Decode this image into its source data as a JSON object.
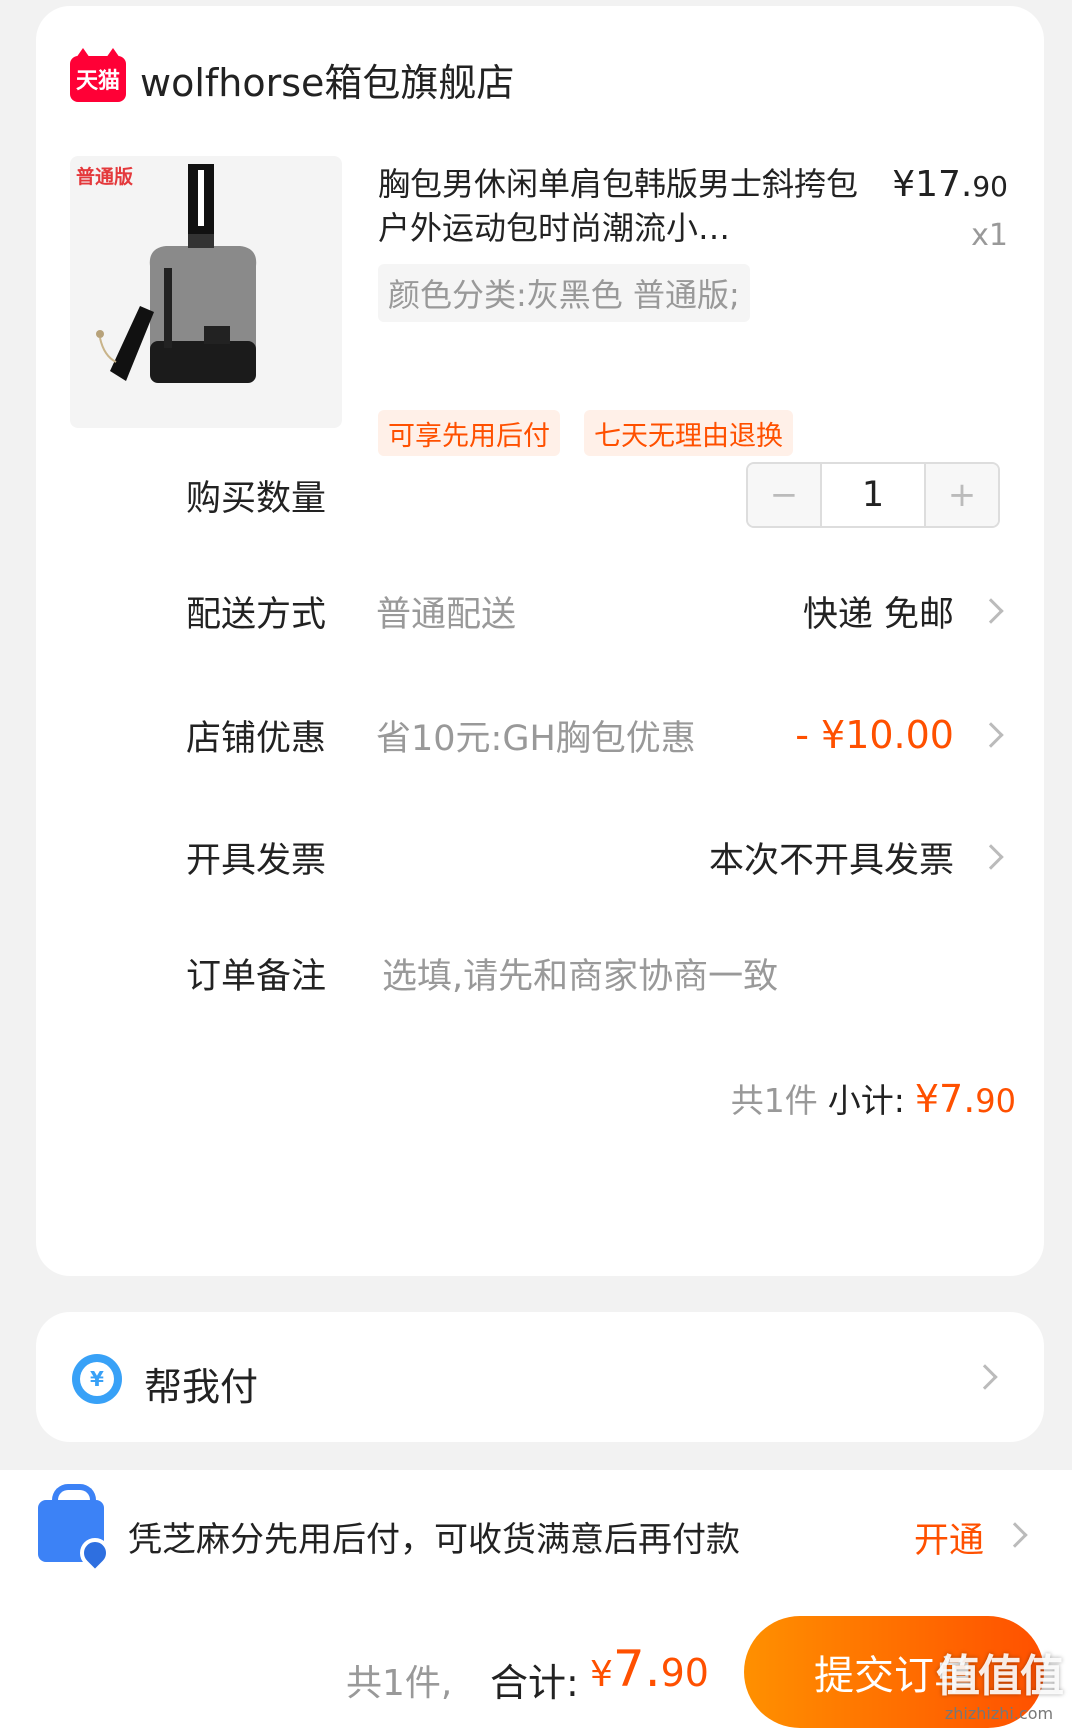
{
  "shop": {
    "badge": "天猫",
    "name": "wolfhorse箱包旗舰店"
  },
  "product": {
    "image_badge": "普通版",
    "title": "胸包男休闲单肩包韩版男士斜挎包户外运动包时尚潮流小…",
    "price_int": "¥17.",
    "price_dec": "90",
    "qty": "x1",
    "sku": "颜色分类:灰黑色 普通版;",
    "tags": [
      "可享先用后付",
      "七天无理由退换"
    ]
  },
  "rows": {
    "quantity_label": "购买数量",
    "quantity_value": "1",
    "minus": "−",
    "plus": "+",
    "delivery_label": "配送方式",
    "delivery_sub": "普通配送",
    "delivery_value": "快递 免邮",
    "discount_label": "店铺优惠",
    "discount_sub": "省10元:GH胸包优惠",
    "discount_value": "- ¥10.00",
    "invoice_label": "开具发票",
    "invoice_value": "本次不开具发票",
    "note_label": "订单备注",
    "note_placeholder": "选填,请先和商家协商一致"
  },
  "subtotal": {
    "count": "共1件",
    "label": "小计:",
    "price_int": "¥7.",
    "price_dec": "90"
  },
  "help_pay": {
    "icon_symbol": "¥",
    "label": "帮我付"
  },
  "pay_later": {
    "text": "凭芝麻分先用后付，可收货满意后再付款",
    "link": "开通"
  },
  "bottom": {
    "count": "共1件,",
    "total_label": "合计:",
    "currency": "¥",
    "total_int": "7.",
    "total_dec": "90",
    "submit": "提交订单"
  },
  "watermark": {
    "text": "值值值",
    "url": "zhizhizhi.com"
  },
  "colors": {
    "accent": "#ff5000",
    "tmall_red": "#ff0036",
    "help_blue": "#38a1f7"
  }
}
